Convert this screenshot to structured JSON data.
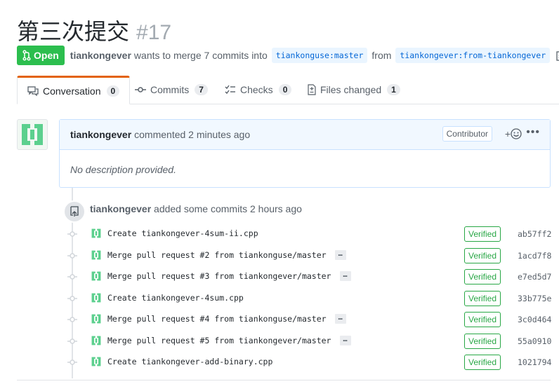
{
  "pr": {
    "title": "第三次提交",
    "number": "#17",
    "state": "Open",
    "author": "tiankongever",
    "merge_text": "wants to merge 7 commits into",
    "base_ref": "tiankonguse:master",
    "from_text": "from",
    "head_ref": "tiankongever:from-tiankongever"
  },
  "tabs": [
    {
      "label": "Conversation",
      "count": "0"
    },
    {
      "label": "Commits",
      "count": "7"
    },
    {
      "label": "Checks",
      "count": "0"
    },
    {
      "label": "Files changed",
      "count": "1"
    }
  ],
  "comment": {
    "author": "tiankongever",
    "action": "commented 2 minutes ago",
    "badge": "Contributor",
    "react": "+",
    "menu": "•••",
    "body": "No description provided."
  },
  "commits_header": {
    "author": "tiankongever",
    "action": "added some commits 2 hours ago"
  },
  "commits": [
    {
      "message": "Create tiankongever-4sum-ii.cpp",
      "has_more": false,
      "verified": "Verified",
      "sha": "ab57ff2"
    },
    {
      "message": "Merge pull request #2 from tiankonguse/master",
      "has_more": true,
      "verified": "Verified",
      "sha": "1acd7f8"
    },
    {
      "message": "Merge pull request #3 from tiankongever/master",
      "has_more": true,
      "verified": "Verified",
      "sha": "e7ed5d7"
    },
    {
      "message": "Create tiankongever-4sum.cpp",
      "has_more": false,
      "verified": "Verified",
      "sha": "33b775e"
    },
    {
      "message": "Merge pull request #4 from tiankonguse/master",
      "has_more": true,
      "verified": "Verified",
      "sha": "3c0d464"
    },
    {
      "message": "Merge pull request #5 from tiankongever/master",
      "has_more": true,
      "verified": "Verified",
      "sha": "55a0910"
    },
    {
      "message": "Create tiankongever-add-binary.cpp",
      "has_more": false,
      "verified": "Verified",
      "sha": "1021794"
    }
  ],
  "ellipsis_label": "…",
  "colors": {
    "open_green": "#2cbe4e",
    "tab_accent": "#e36209",
    "link_blue": "#0366d6",
    "verified_green": "#28a745"
  }
}
